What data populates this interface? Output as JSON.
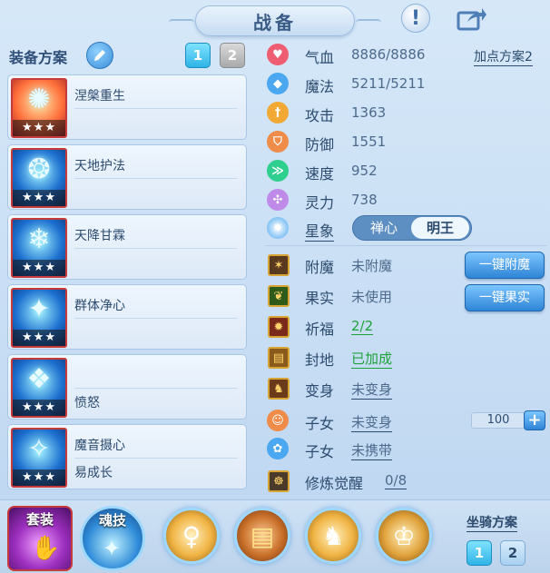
{
  "header": {
    "title": "战备"
  },
  "plan": {
    "label": "装备方案",
    "buttons": [
      "1",
      "2"
    ]
  },
  "skills": [
    {
      "name": "涅槃重生",
      "sub": "",
      "stars": "★★★",
      "glyph": "✺"
    },
    {
      "name": "天地护法",
      "sub": "",
      "stars": "★★★",
      "glyph": "❂"
    },
    {
      "name": "天降甘霖",
      "sub": "",
      "stars": "★★★",
      "glyph": "❄"
    },
    {
      "name": "群体净心",
      "sub": "",
      "stars": "★★★",
      "glyph": "✦"
    },
    {
      "name": "",
      "sub": "愤怒",
      "stars": "★★★",
      "glyph": "❖"
    },
    {
      "name": "魔音摄心",
      "sub": "易成长",
      "stars": "★★★",
      "glyph": "✧"
    }
  ],
  "stats": [
    {
      "label": "气血",
      "value": "8886/8886",
      "icon": "heart-icon",
      "color": "#ef5d73"
    },
    {
      "label": "魔法",
      "value": "5211/5211",
      "icon": "mana-icon",
      "color": "#4aa7f0"
    },
    {
      "label": "攻击",
      "value": "1363",
      "icon": "sword-icon",
      "color": "#f2a934"
    },
    {
      "label": "防御",
      "value": "1551",
      "icon": "shield-icon",
      "color": "#f08c4a"
    },
    {
      "label": "速度",
      "value": "952",
      "icon": "speed-icon",
      "color": "#2ecf8f"
    },
    {
      "label": "灵力",
      "value": "738",
      "icon": "spirit-icon",
      "color": "#c08be8"
    }
  ],
  "add_plan": "加点方案2",
  "star_sign": {
    "label": "星象",
    "options": [
      "禅心",
      "明王"
    ]
  },
  "enhancements": [
    {
      "label": "附魔",
      "value": "未附魔",
      "value_style": "plain",
      "glyph": "✶"
    },
    {
      "label": "果实",
      "value": "未使用",
      "value_style": "plain",
      "glyph": "❦"
    },
    {
      "label": "祈福",
      "value": "2/2",
      "value_style": "green-underline",
      "glyph": "✹"
    },
    {
      "label": "封地",
      "value": "已加成",
      "value_style": "green-underline",
      "glyph": "▤"
    },
    {
      "label": "变身",
      "value": "未变身",
      "value_style": "underline",
      "glyph": "♞"
    }
  ],
  "buttons": {
    "enchant": "一键附魔",
    "fruit": "一键果实"
  },
  "children": [
    {
      "label": "子女",
      "value": "未变身",
      "icon": "child-icon"
    },
    {
      "label": "子女",
      "value": "未携带",
      "icon": "paw-icon"
    }
  ],
  "stepper": {
    "value": "100",
    "plus": "+"
  },
  "cultivation": {
    "label": "修炼觉醒",
    "value": "0/8"
  },
  "bottom": {
    "set_label": "套装",
    "soul_label": "魂技",
    "mount_label": "坐骑方案",
    "mount_buttons": [
      "1",
      "2"
    ]
  }
}
